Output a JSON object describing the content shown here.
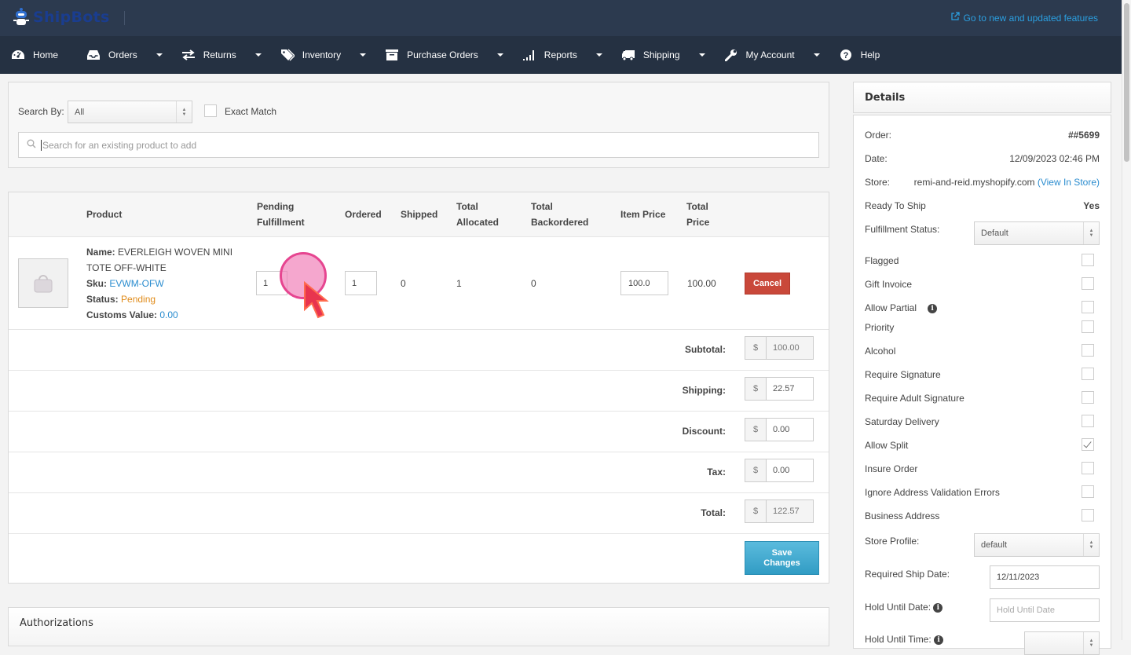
{
  "app": {
    "brand": "ShipBots",
    "new_features_link": "Go to new and updated features"
  },
  "nav": [
    {
      "label": "Home",
      "icon": "dashboard-icon",
      "dropdown": false
    },
    {
      "label": "Orders",
      "icon": "inbox-icon",
      "dropdown": true
    },
    {
      "label": "Returns",
      "icon": "exchange-icon",
      "dropdown": true
    },
    {
      "label": "Inventory",
      "icon": "tags-icon",
      "dropdown": true
    },
    {
      "label": "Purchase Orders",
      "icon": "archive-box-icon",
      "dropdown": true
    },
    {
      "label": "Reports",
      "icon": "signal-bars-icon",
      "dropdown": true
    },
    {
      "label": "Shipping",
      "icon": "truck-icon",
      "dropdown": true
    },
    {
      "label": "My Account",
      "icon": "wrench-icon",
      "dropdown": true
    },
    {
      "label": "Help",
      "icon": "question-circle-icon",
      "dropdown": false
    }
  ],
  "search": {
    "search_by_label": "Search By:",
    "search_by_value": "All",
    "exact_match_label": "Exact Match",
    "exact_match_checked": false,
    "placeholder": "Search for an existing product to add"
  },
  "items_table": {
    "headers": {
      "product": "Product",
      "pending_1": "Pending",
      "pending_2": "Fulfillment",
      "ordered": "Ordered",
      "shipped": "Shipped",
      "allocated_1": "Total",
      "allocated_2": "Allocated",
      "backordered_1": "Total",
      "backordered_2": "Backordered",
      "item_price": "Item Price",
      "total_price_1": "Total",
      "total_price_2": "Price"
    },
    "rows": [
      {
        "name_label": "Name:",
        "name_line1": "EVERLEIGH WOVEN MINI",
        "name_line2": "TOTE OFF-WHITE",
        "sku_label": "Sku:",
        "sku": "EVWM-OFW",
        "status_label": "Status:",
        "status": "Pending",
        "customs_label": "Customs Value:",
        "customs_value": "0.00",
        "pending_fulfillment": "1",
        "ordered": "1",
        "shipped": "0",
        "total_allocated": "1",
        "total_backordered": "0",
        "item_price": "100.0",
        "total_price": "100.00",
        "cancel_label": "Cancel"
      }
    ]
  },
  "summary": {
    "currency": "$",
    "subtotal_label": "Subtotal:",
    "subtotal": "100.00",
    "shipping_label": "Shipping:",
    "shipping": "22.57",
    "discount_label": "Discount:",
    "discount": "0.00",
    "tax_label": "Tax:",
    "tax": "0.00",
    "total_label": "Total:",
    "total": "122.57",
    "save_label_1": "Save",
    "save_label_2": "Changes"
  },
  "authorizations": {
    "title": "Authorizations"
  },
  "details": {
    "title": "Details",
    "order_label": "Order:",
    "order_value": "##5699",
    "date_label": "Date:",
    "date_value": "12/09/2023 02:46 PM",
    "store_label": "Store:",
    "store_value": "remi-and-reid.myshopify.com",
    "store_link": "(View In Store)",
    "ready_label": "Ready To Ship",
    "ready_value": "Yes",
    "fulfillment_label": "Fulfillment Status:",
    "fulfillment_value": "Default",
    "flags": [
      {
        "label": "Flagged",
        "checked": false
      },
      {
        "label": "Gift Invoice",
        "checked": false
      },
      {
        "label": "Allow Partial",
        "checked": false,
        "info": true
      },
      {
        "label": "Priority",
        "checked": false
      },
      {
        "label": "Alcohol",
        "checked": false
      },
      {
        "label": "Require Signature",
        "checked": false
      },
      {
        "label": "Require Adult Signature",
        "checked": false
      },
      {
        "label": "Saturday Delivery",
        "checked": false
      },
      {
        "label": "Allow Split",
        "checked": true
      },
      {
        "label": "Insure Order",
        "checked": false
      },
      {
        "label": "Ignore Address Validation Errors",
        "checked": false
      },
      {
        "label": "Business Address",
        "checked": false
      }
    ],
    "store_profile_label": "Store Profile:",
    "store_profile_value": "default",
    "required_ship_label": "Required Ship Date:",
    "required_ship_value": "12/11/2023",
    "hold_date_label": "Hold Until Date:",
    "hold_date_placeholder": "Hold Until Date",
    "hold_time_label": "Hold Until Time:"
  },
  "colors": {
    "nav_bg": "#253142",
    "top_bg": "#2c3a4f",
    "link": "#2a8ccf",
    "cancel": "#c9483a",
    "save": "#319cc4",
    "pending": "#e08b19"
  }
}
